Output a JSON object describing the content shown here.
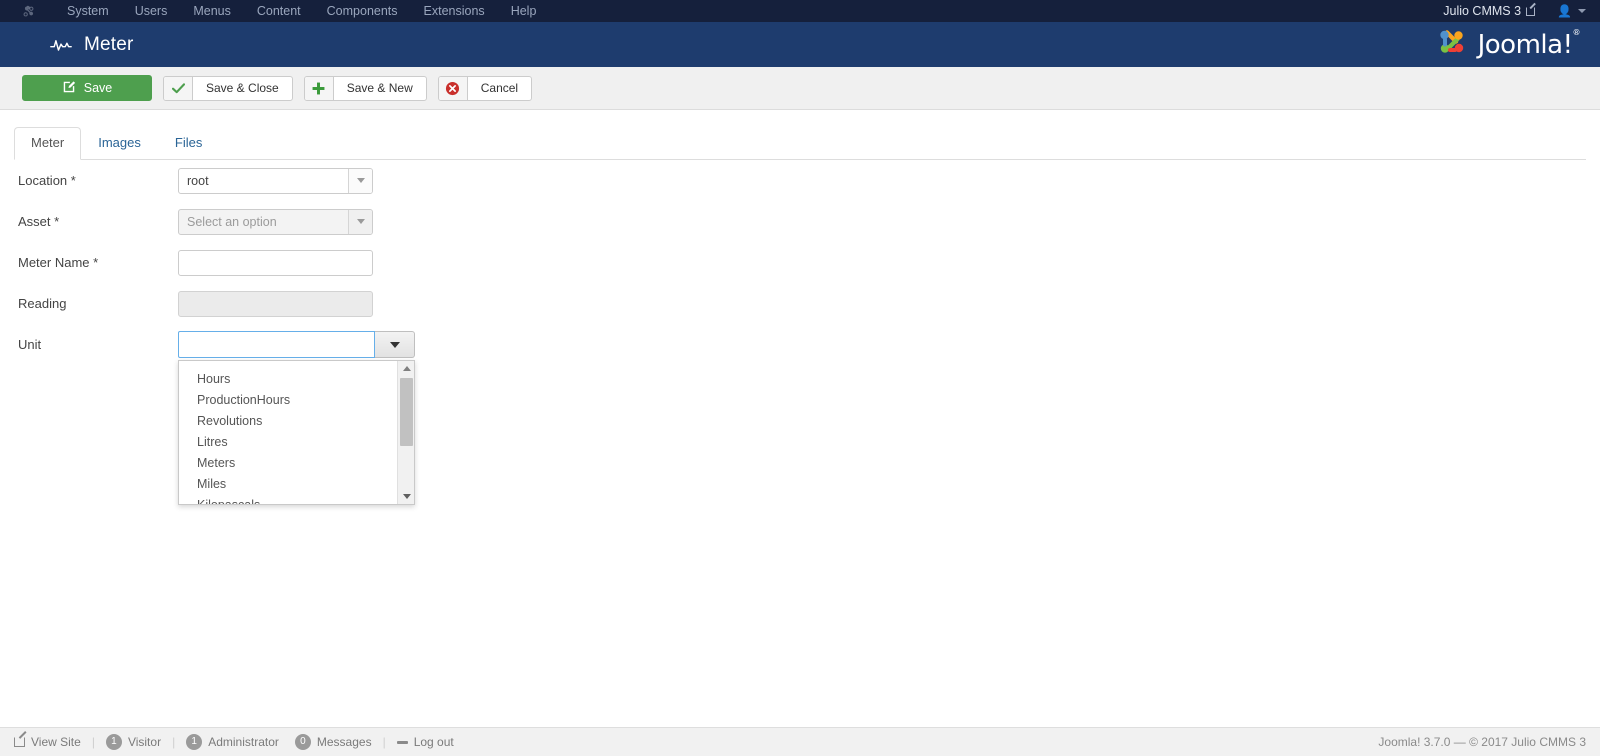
{
  "admin_bar": {
    "logo_icon": "joomla-mini-logo-icon",
    "menu": [
      {
        "label": "System"
      },
      {
        "label": "Users"
      },
      {
        "label": "Menus"
      },
      {
        "label": "Content"
      },
      {
        "label": "Components"
      },
      {
        "label": "Extensions"
      },
      {
        "label": "Help"
      }
    ],
    "site_name": "Julio CMMS 3",
    "external_link_icon": "external-link-icon",
    "user_icon": "user-avatar-icon",
    "user_caret_icon": "chevron-down-icon"
  },
  "header": {
    "icon": "pulse-meter-icon",
    "title": "Meter",
    "brand_text": "Joomla!",
    "brand_sup": "®",
    "brand_logo_icon": "joomla-logo-icon"
  },
  "toolbar": {
    "save": {
      "label": "Save",
      "icon": "save-pencil-icon",
      "color": "#4e9f4e"
    },
    "save_close": {
      "label": "Save & Close",
      "icon": "check-icon"
    },
    "save_new": {
      "label": "Save & New",
      "icon": "plus-icon"
    },
    "cancel": {
      "label": "Cancel",
      "icon": "cancel-circle-icon",
      "color": "#c9302c"
    }
  },
  "tabs": [
    {
      "label": "Meter",
      "active": true
    },
    {
      "label": "Images",
      "active": false
    },
    {
      "label": "Files",
      "active": false
    }
  ],
  "form": {
    "location": {
      "label": "Location *",
      "value": "root",
      "arrow_icon": "dropdown-arrow-icon"
    },
    "asset": {
      "label": "Asset *",
      "placeholder": "Select an option",
      "value": "",
      "arrow_icon": "dropdown-arrow-icon"
    },
    "meter_name": {
      "label": "Meter Name *",
      "value": "",
      "placeholder": ""
    },
    "reading": {
      "label": "Reading",
      "value": "",
      "placeholder": "",
      "readonly": true
    },
    "unit": {
      "label": "Unit",
      "value": "",
      "placeholder": "",
      "focused": true,
      "toggle_icon": "caret-down-icon",
      "dropdown_open": true,
      "options": [
        "Hours",
        "ProductionHours",
        "Revolutions",
        "Litres",
        "Meters",
        "Miles",
        "Kilopascals"
      ],
      "scrollbar": {
        "up_icon": "scroll-up-arrow-icon",
        "down_icon": "scroll-down-arrow-icon"
      }
    }
  },
  "status_bar": {
    "view_site": {
      "label": "View Site",
      "icon": "external-link-icon"
    },
    "visitor": {
      "count": "1",
      "label": "Visitor"
    },
    "administrator": {
      "count": "1",
      "label": "Administrator"
    },
    "messages": {
      "count": "0",
      "label": "Messages"
    },
    "logout": {
      "label": "Log out",
      "icon": "logout-icon"
    },
    "copyright": "Joomla! 3.7.0  —  © 2017 Julio CMMS 3"
  }
}
